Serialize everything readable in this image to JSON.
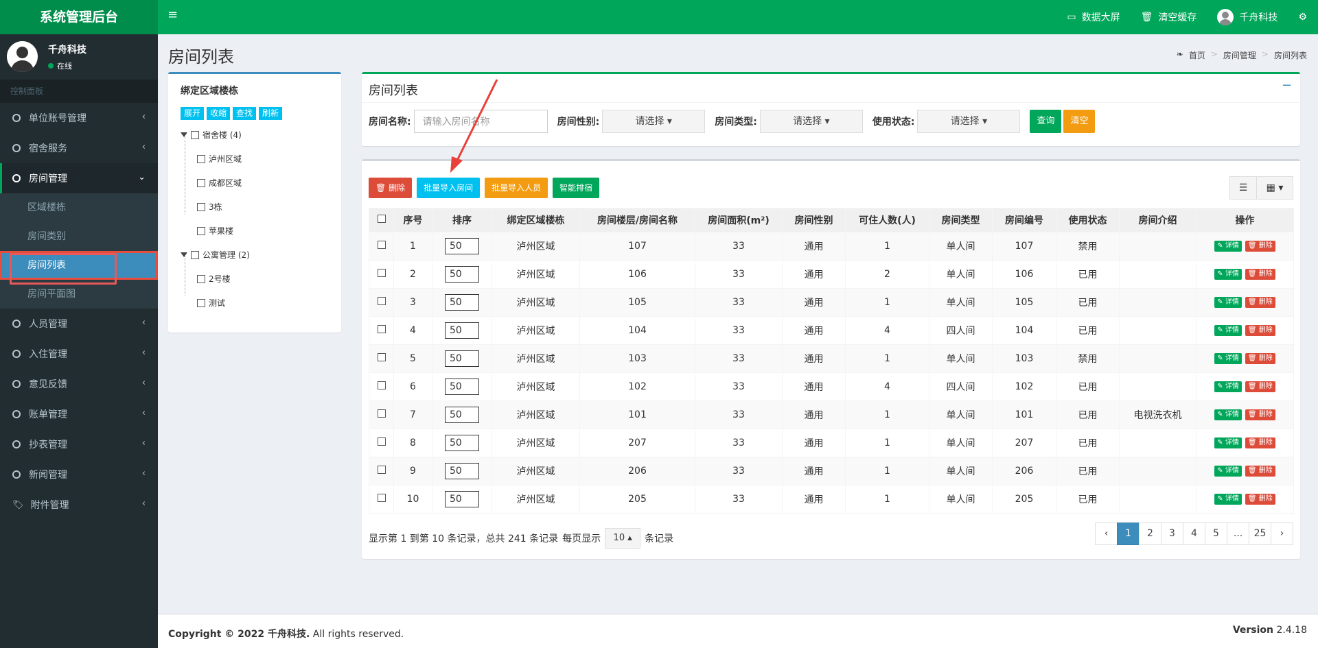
{
  "brand": "系统管理后台",
  "topnav": {
    "screen": "数据大屏",
    "cache": "清空缓存",
    "user": "千舟科技"
  },
  "user": {
    "name": "千舟科技",
    "status": "在线"
  },
  "sidebar": {
    "header": "控制面板",
    "items": [
      "单位账号管理",
      "宿舍服务",
      "房间管理",
      "人员管理",
      "入住管理",
      "意见反馈",
      "账单管理",
      "抄表管理",
      "新闻管理",
      "附件管理"
    ],
    "submenu": [
      "区域楼栋",
      "房间类别",
      "房间列表",
      "房间平面图"
    ]
  },
  "page_title": "房间列表",
  "breadcrumb": [
    "首页",
    "房间管理",
    "房间列表"
  ],
  "tree": {
    "title": "绑定区域楼栋",
    "buttons": [
      "展开",
      "收缩",
      "查找",
      "刷新"
    ],
    "nodes": {
      "root1": "宿舍楼 (4)",
      "c1": "泸州区域",
      "c2": "成都区域",
      "c3": "3栋",
      "c4": "苹果楼",
      "root2": "公寓管理 (2)",
      "c5": "2号楼",
      "c6": "测试"
    }
  },
  "search": {
    "title": "房间列表",
    "name_label": "房间名称:",
    "name_placeholder": "请输入房间名称",
    "gender_label": "房间性别:",
    "type_label": "房间类型:",
    "status_label": "使用状态:",
    "select_placeholder": "请选择",
    "query": "查询",
    "clear": "清空"
  },
  "toolbar": {
    "delete": "删除",
    "import_rooms": "批量导入房间",
    "import_people": "批量导入人员",
    "smart": "智能排宿"
  },
  "table": {
    "headers": [
      "序号",
      "排序",
      "绑定区域楼栋",
      "房间楼层/房间名称",
      "房间面积(m²)",
      "房间性别",
      "可住人数(人)",
      "房间类型",
      "房间编号",
      "使用状态",
      "房间介绍",
      "操作"
    ],
    "detail": "详情",
    "del": "删除",
    "rows": [
      [
        "1",
        "50",
        "泸州区域",
        "107",
        "33",
        "通用",
        "1",
        "单人间",
        "107",
        "禁用",
        ""
      ],
      [
        "2",
        "50",
        "泸州区域",
        "106",
        "33",
        "通用",
        "2",
        "单人间",
        "106",
        "已用",
        ""
      ],
      [
        "3",
        "50",
        "泸州区域",
        "105",
        "33",
        "通用",
        "1",
        "单人间",
        "105",
        "已用",
        ""
      ],
      [
        "4",
        "50",
        "泸州区域",
        "104",
        "33",
        "通用",
        "4",
        "四人间",
        "104",
        "已用",
        ""
      ],
      [
        "5",
        "50",
        "泸州区域",
        "103",
        "33",
        "通用",
        "1",
        "单人间",
        "103",
        "禁用",
        ""
      ],
      [
        "6",
        "50",
        "泸州区域",
        "102",
        "33",
        "通用",
        "4",
        "四人间",
        "102",
        "已用",
        ""
      ],
      [
        "7",
        "50",
        "泸州区域",
        "101",
        "33",
        "通用",
        "1",
        "单人间",
        "101",
        "已用",
        "电视洗衣机"
      ],
      [
        "8",
        "50",
        "泸州区域",
        "207",
        "33",
        "通用",
        "1",
        "单人间",
        "207",
        "已用",
        ""
      ],
      [
        "9",
        "50",
        "泸州区域",
        "206",
        "33",
        "通用",
        "1",
        "单人间",
        "206",
        "已用",
        ""
      ],
      [
        "10",
        "50",
        "泸州区域",
        "205",
        "33",
        "通用",
        "1",
        "单人间",
        "205",
        "已用",
        ""
      ]
    ]
  },
  "pagination": {
    "info": "显示第 1 到第 10 条记录，总共 241 条记录",
    "per_page_label": "每页显示",
    "per_page": "10",
    "records": "条记录",
    "pages": [
      "‹",
      "1",
      "2",
      "3",
      "4",
      "5",
      "...",
      "25",
      "›"
    ]
  },
  "footer": {
    "copyright": "Copyright © 2022 千舟科技.",
    "rights": " All rights reserved.",
    "version_label": "Version",
    "version": "2.4.18"
  },
  "colors": {
    "green": "#00a65a",
    "blue": "#3c8dbc",
    "red": "#dd4b39",
    "aqua": "#00c0ef",
    "orange": "#f39c12"
  }
}
